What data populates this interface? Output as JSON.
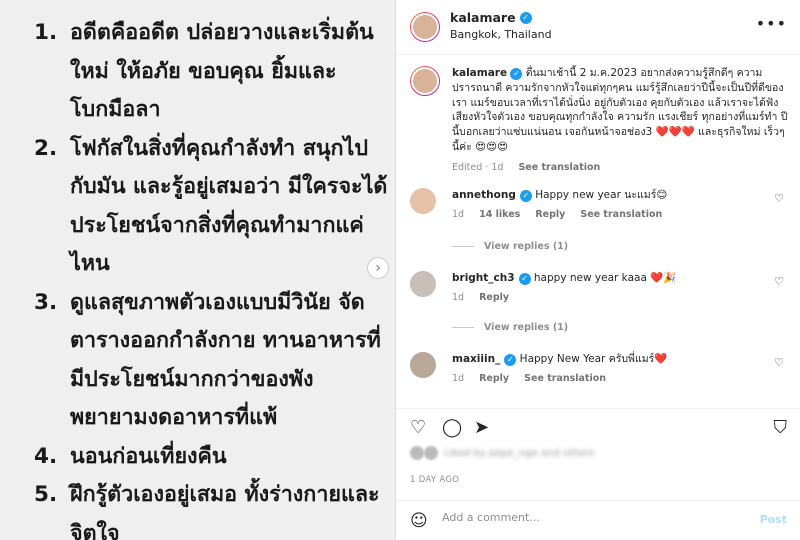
{
  "left_image": {
    "items": [
      {
        "num": "1.",
        "text": "อดีตคืออดีต ปล่อยวางและเริ่มต้นใหม่ ให้อภัย ขอบคุณ ยิ้มและโบกมือลา"
      },
      {
        "num": "2.",
        "text": "โฟกัสในสิ่งที่คุณกำลังทำ สนุกไปกับมัน และรู้อยู่เสมอว่า มีใครจะได้ประโยชน์จากสิ่งที่คุณทำมากแค่ไหน"
      },
      {
        "num": "3.",
        "text": "ดูแลสุขภาพตัวเองแบบมีวินัย จัดตารางออกกำลังกาย ทานอาหารที่มีประโยชน์มากกว่าของพัง พยายามงดอาหารที่แพ้"
      },
      {
        "num": "4.",
        "text": "นอนก่อนเที่ยงคืน"
      },
      {
        "num": "5.",
        "text": "ฝึกรู้ตัวเองอยู่เสมอ ทั้งร่างกายและจิตใจ"
      }
    ],
    "next_icon": "chevron-right-icon"
  },
  "header": {
    "username": "kalamare",
    "location": "Bangkok, Thailand",
    "more_icon": "•••"
  },
  "caption": {
    "username": "kalamare",
    "text": "ตื่นมาเช้านี้ 2 ม.ค.2023 อยากส่งความรู้สึกดีๆ ความปรารถนาดี ความรักจากหัวใจแด่ทุกๆคน แมร์รู้สึกเลยว่าปีนี้จะเป็นปีที่ดีของเรา แมร์ขอบเวลาที่เราได้นั่งนิ่ง อยู่กับตัวเอง คุยกับตัวเอง แล้วเราจะได้ฟังเสียงหัวใจตัวเอง ขอบคุณทุกกำลังใจ ความรัก แรงเชียร์ ทุกอย่างที่แมร์ทำ ปีนี้บอกเลยว่าแซ่บแน่นอน เจอกันหน้าจอช่อง3 ❤️❤️❤️ และธุรกิจใหม่ เร็วๆนี้ค่ะ 😍😍😍",
    "edited": "Edited · 1d",
    "see_translation": "See translation"
  },
  "comments": [
    {
      "username": "annethong",
      "text": "Happy new year นะแมร์😊",
      "time": "1d",
      "likes": "14 likes",
      "reply": "Reply",
      "see_translation": "See translation",
      "view_replies": "View replies (1)"
    },
    {
      "username": "bright_ch3",
      "text": "happy new year kaaa ❤️🎉",
      "time": "1d",
      "reply": "Reply",
      "view_replies": "View replies (1)"
    },
    {
      "username": "maxiiin_",
      "text": "Happy New Year ครับพี่แมร์❤️",
      "time": "1d",
      "reply": "Reply",
      "see_translation": "See translation"
    }
  ],
  "actions": {
    "like_icon": "heart-icon",
    "comment_icon": "comment-icon",
    "share_icon": "share-icon",
    "save_icon": "bookmark-icon"
  },
  "likes_text": "Liked by pepe_nge and others",
  "timestamp": "1 DAY AGO",
  "add_comment": {
    "placeholder": "Add a comment...",
    "post_label": "Post"
  }
}
